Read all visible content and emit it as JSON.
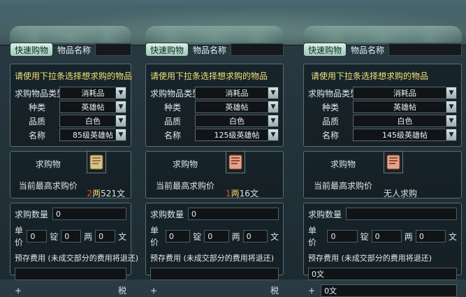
{
  "panels": [
    {
      "quick_buy": "快速购物",
      "item_name_label": "物品名称",
      "prompt": "请使用下拉条选择想求购的物品",
      "fields": [
        {
          "label": "求购物品类型",
          "value": "消耗品"
        },
        {
          "label": "种类",
          "value": "英雄帖"
        },
        {
          "label": "品质",
          "value": "白色"
        },
        {
          "label": "名称",
          "value": "85级英雄帖"
        }
      ],
      "goods_label": "求购物",
      "highest_label": "当前最高求购价",
      "highest_price": {
        "liang": "2",
        "liang_unit": "两",
        "wen": "521",
        "wen_unit": "文"
      },
      "qty_label": "求购数量",
      "qty_value": "0",
      "unit_label": "单价",
      "ding_label": "锭",
      "liang_label": "两",
      "wen_label": "文",
      "unit_values": {
        "ding": "0",
        "liang": "0",
        "wen": "0"
      },
      "prepay_label": "预存费用 (未成交部分的费用将退还)",
      "tax_plus": "+",
      "tax_label": "税"
    },
    {
      "quick_buy": "快速购物",
      "item_name_label": "物品名称",
      "prompt": "请使用下拉条选择想求购的物品",
      "fields": [
        {
          "label": "求购物品类型",
          "value": "消耗品"
        },
        {
          "label": "种类",
          "value": "英雄帖"
        },
        {
          "label": "品质",
          "value": "白色"
        },
        {
          "label": "名称",
          "value": "125级英雄帖"
        }
      ],
      "goods_label": "求购物",
      "highest_label": "当前最高求购价",
      "highest_price": {
        "liang": "1",
        "liang_unit": "两",
        "wen": "16",
        "wen_unit": "文"
      },
      "qty_label": "求购数量",
      "qty_value": "0",
      "unit_label": "单价",
      "ding_label": "锭",
      "liang_label": "两",
      "wen_label": "文",
      "unit_values": {
        "ding": "0",
        "liang": "0",
        "wen": "0"
      },
      "prepay_label": "预存费用 (未成交部分的费用将退还)",
      "tax_plus": "+",
      "tax_label": "税"
    },
    {
      "quick_buy": "快速购物",
      "item_name_label": "物品名称",
      "prompt": "请使用下拉条选择想求购的物品",
      "fields": [
        {
          "label": "求购物品类型",
          "value": "消耗品"
        },
        {
          "label": "种类",
          "value": "英雄帖"
        },
        {
          "label": "品质",
          "value": "白色"
        },
        {
          "label": "名称",
          "value": "145级英雄帖"
        }
      ],
      "goods_label": "求购物",
      "highest_label": "当前最高求购价",
      "highest_none": "无人求购",
      "qty_label": "求购数量",
      "qty_value": "",
      "unit_label": "单价",
      "ding_label": "锭",
      "liang_label": "两",
      "wen_label": "文",
      "unit_values": {
        "ding": "0",
        "liang": "0",
        "wen": "0"
      },
      "prepay_label": "预存费用 (未成交部分的费用将退还)",
      "prepay_value": "0文",
      "tax_plus": "+",
      "tax_value": "0文"
    }
  ],
  "icons": {
    "dropdown_arrow": "▼",
    "goods_icon": "scroll-icon"
  },
  "colors": {
    "accent_yellow": "#f1e07a",
    "price_red": "#e64b3c",
    "price_gold": "#f2d36c"
  }
}
